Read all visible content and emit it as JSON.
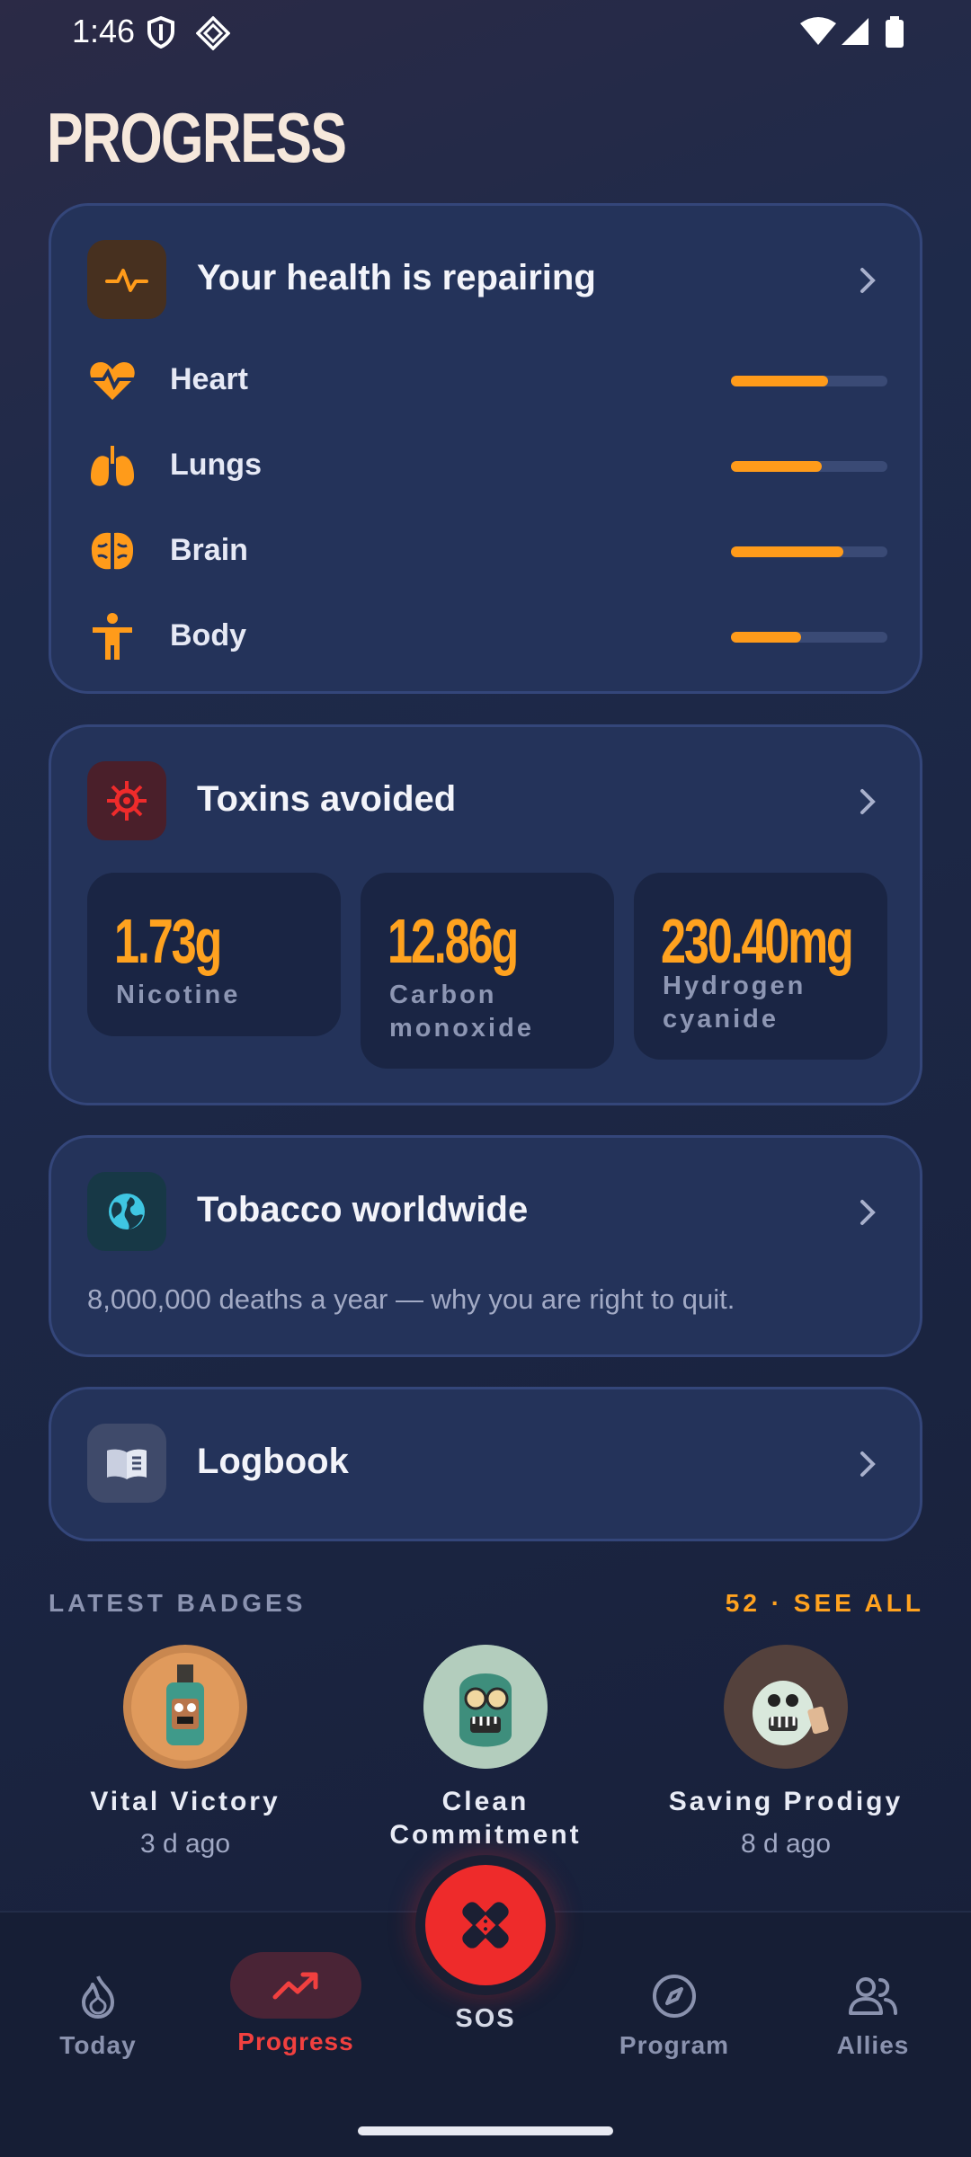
{
  "status_bar": {
    "time": "1:46"
  },
  "page": {
    "title": "PROGRESS"
  },
  "health_card": {
    "title": "Your health is repairing",
    "items": [
      {
        "label": "Heart",
        "progress": 0.62,
        "icon": "heart-pulse-icon"
      },
      {
        "label": "Lungs",
        "progress": 0.58,
        "icon": "lungs-icon"
      },
      {
        "label": "Brain",
        "progress": 0.72,
        "icon": "brain-icon"
      },
      {
        "label": "Body",
        "progress": 0.45,
        "icon": "body-icon"
      }
    ]
  },
  "toxins_card": {
    "title": "Toxins avoided",
    "items": [
      {
        "value": "1.73g",
        "label": "Nicotine"
      },
      {
        "value": "12.86g",
        "label": "Carbon monoxide"
      },
      {
        "value": "230.40mg",
        "label": "Hydrogen cyanide"
      }
    ]
  },
  "tobacco_card": {
    "title": "Tobacco worldwide",
    "note": "8,000,000 deaths a year — why you are right to quit."
  },
  "logbook_card": {
    "title": "Logbook"
  },
  "badges": {
    "section_label": "LATEST BADGES",
    "see_all": "52 · SEE ALL",
    "items": [
      {
        "name": "Vital Victory",
        "when": "3 d ago"
      },
      {
        "name": "Clean Commitment",
        "when": ""
      },
      {
        "name": "Saving Prodigy",
        "when": "8 d ago"
      }
    ]
  },
  "nav": {
    "today": "Today",
    "progress": "Progress",
    "sos": "SOS",
    "program": "Program",
    "allies": "Allies"
  },
  "colors": {
    "accent": "#ffa21f",
    "danger": "#ee2b2b",
    "card": "#24335a"
  }
}
